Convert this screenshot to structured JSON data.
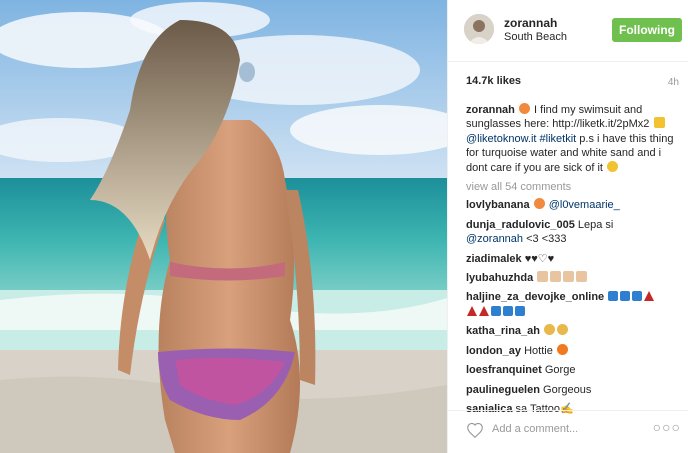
{
  "post": {
    "username": "zorannah",
    "location": "South Beach",
    "follow_label": "Following",
    "likes": "14.7k likes",
    "time": "4h"
  },
  "caption": {
    "user": "zorannah",
    "text1": "I find my swimsuit and sunglasses here: http://liketk.it/2pMx2",
    "mention1": "@liketoknow.it",
    "hashtag1": "#liketkit",
    "text2": "p.s i have this thing for turquoise water and white sand and i dont care if you are sick of it"
  },
  "view_all": "view all 54 comments",
  "comments": [
    {
      "user": "lovlybanana",
      "mention": "@l0vemaarie_"
    },
    {
      "user": "dunja_radulovic_005",
      "text": "Lepa si",
      "mention": "@zorannah",
      "text2": "<3 <333"
    },
    {
      "user": "ziadimalek",
      "text": "♥♥♡♥"
    },
    {
      "user": "lyubahuzhda"
    },
    {
      "user": "haljine_za_devojke_online"
    },
    {
      "user": "katha_rina_ah"
    },
    {
      "user": "london_ay",
      "text": "Hottie"
    },
    {
      "user": "loesfranquinet",
      "text": "Gorge"
    },
    {
      "user": "paulineguelen",
      "text": "Gorgeous"
    },
    {
      "user": "sanialica",
      "text": "sa Tattoo✍"
    }
  ],
  "add_comment_placeholder": "Add a comment...",
  "more_label": "○○○",
  "colors": {
    "follow": "#70c050",
    "link": "#003569",
    "sea": "#2aa6a8",
    "sky": "#9cc8ea"
  },
  "icons": [
    "heart-icon",
    "more-options-icon",
    "emoji-icon"
  ]
}
